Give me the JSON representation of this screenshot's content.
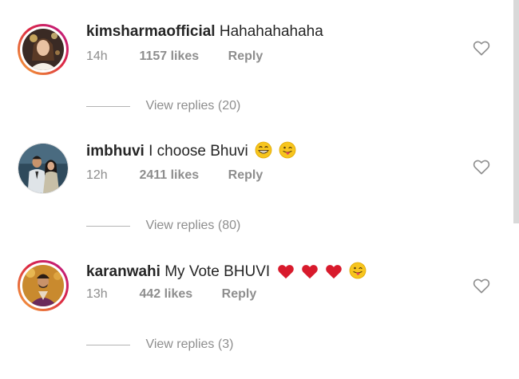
{
  "comments": [
    {
      "username": "kimsharmaofficial",
      "text": "Hahahahahaha",
      "time": "14h",
      "likes": "1157 likes",
      "reply": "Reply",
      "view_replies": "View replies (20)"
    },
    {
      "username": "imbhuvi",
      "text": "I choose Bhuvi",
      "emojis": [
        "grinning-face-emoji",
        "winking-tongue-face-emoji"
      ],
      "time": "12h",
      "likes": "2411 likes",
      "reply": "Reply",
      "view_replies": "View replies (80)"
    },
    {
      "username": "karanwahi",
      "text": "My Vote BHUVI",
      "emojis": [
        "red-heart-emoji",
        "red-heart-emoji",
        "red-heart-emoji",
        "winking-tongue-face-emoji"
      ],
      "time": "13h",
      "likes": "442 likes",
      "reply": "Reply",
      "view_replies": "View replies (3)"
    }
  ],
  "colors": {
    "text_primary": "#262626",
    "text_secondary": "#8e8e8e",
    "story_ring_start": "#f9a33a",
    "story_ring_end": "#bc1888",
    "heart_red": "#e0182d",
    "emoji_yellow": "#f7c51e"
  }
}
